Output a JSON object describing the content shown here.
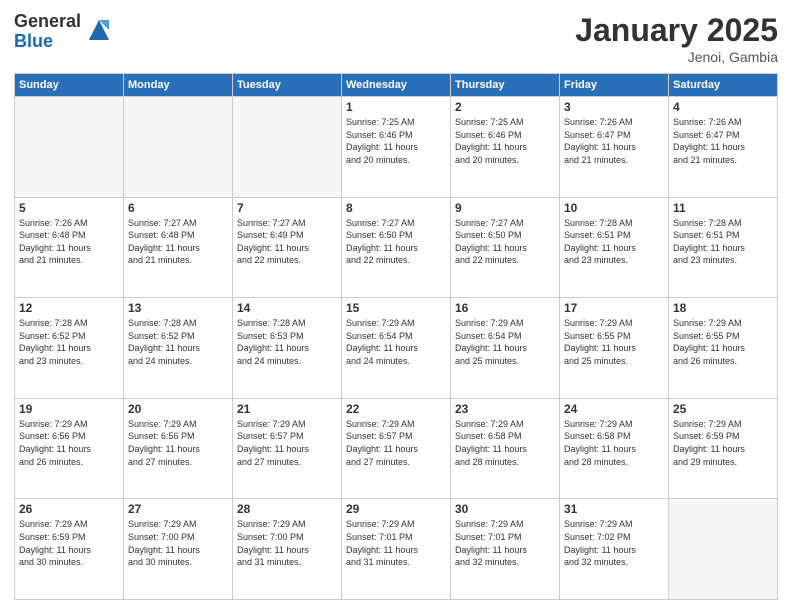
{
  "header": {
    "logo_general": "General",
    "logo_blue": "Blue",
    "title": "January 2025",
    "subtitle": "Jenoi, Gambia"
  },
  "days_of_week": [
    "Sunday",
    "Monday",
    "Tuesday",
    "Wednesday",
    "Thursday",
    "Friday",
    "Saturday"
  ],
  "weeks": [
    [
      {
        "num": "",
        "info": ""
      },
      {
        "num": "",
        "info": ""
      },
      {
        "num": "",
        "info": ""
      },
      {
        "num": "1",
        "info": "Sunrise: 7:25 AM\nSunset: 6:46 PM\nDaylight: 11 hours\nand 20 minutes."
      },
      {
        "num": "2",
        "info": "Sunrise: 7:25 AM\nSunset: 6:46 PM\nDaylight: 11 hours\nand 20 minutes."
      },
      {
        "num": "3",
        "info": "Sunrise: 7:26 AM\nSunset: 6:47 PM\nDaylight: 11 hours\nand 21 minutes."
      },
      {
        "num": "4",
        "info": "Sunrise: 7:26 AM\nSunset: 6:47 PM\nDaylight: 11 hours\nand 21 minutes."
      }
    ],
    [
      {
        "num": "5",
        "info": "Sunrise: 7:26 AM\nSunset: 6:48 PM\nDaylight: 11 hours\nand 21 minutes."
      },
      {
        "num": "6",
        "info": "Sunrise: 7:27 AM\nSunset: 6:48 PM\nDaylight: 11 hours\nand 21 minutes."
      },
      {
        "num": "7",
        "info": "Sunrise: 7:27 AM\nSunset: 6:49 PM\nDaylight: 11 hours\nand 22 minutes."
      },
      {
        "num": "8",
        "info": "Sunrise: 7:27 AM\nSunset: 6:50 PM\nDaylight: 11 hours\nand 22 minutes."
      },
      {
        "num": "9",
        "info": "Sunrise: 7:27 AM\nSunset: 6:50 PM\nDaylight: 11 hours\nand 22 minutes."
      },
      {
        "num": "10",
        "info": "Sunrise: 7:28 AM\nSunset: 6:51 PM\nDaylight: 11 hours\nand 23 minutes."
      },
      {
        "num": "11",
        "info": "Sunrise: 7:28 AM\nSunset: 6:51 PM\nDaylight: 11 hours\nand 23 minutes."
      }
    ],
    [
      {
        "num": "12",
        "info": "Sunrise: 7:28 AM\nSunset: 6:52 PM\nDaylight: 11 hours\nand 23 minutes."
      },
      {
        "num": "13",
        "info": "Sunrise: 7:28 AM\nSunset: 6:52 PM\nDaylight: 11 hours\nand 24 minutes."
      },
      {
        "num": "14",
        "info": "Sunrise: 7:28 AM\nSunset: 6:53 PM\nDaylight: 11 hours\nand 24 minutes."
      },
      {
        "num": "15",
        "info": "Sunrise: 7:29 AM\nSunset: 6:54 PM\nDaylight: 11 hours\nand 24 minutes."
      },
      {
        "num": "16",
        "info": "Sunrise: 7:29 AM\nSunset: 6:54 PM\nDaylight: 11 hours\nand 25 minutes."
      },
      {
        "num": "17",
        "info": "Sunrise: 7:29 AM\nSunset: 6:55 PM\nDaylight: 11 hours\nand 25 minutes."
      },
      {
        "num": "18",
        "info": "Sunrise: 7:29 AM\nSunset: 6:55 PM\nDaylight: 11 hours\nand 26 minutes."
      }
    ],
    [
      {
        "num": "19",
        "info": "Sunrise: 7:29 AM\nSunset: 6:56 PM\nDaylight: 11 hours\nand 26 minutes."
      },
      {
        "num": "20",
        "info": "Sunrise: 7:29 AM\nSunset: 6:56 PM\nDaylight: 11 hours\nand 27 minutes."
      },
      {
        "num": "21",
        "info": "Sunrise: 7:29 AM\nSunset: 6:57 PM\nDaylight: 11 hours\nand 27 minutes."
      },
      {
        "num": "22",
        "info": "Sunrise: 7:29 AM\nSunset: 6:57 PM\nDaylight: 11 hours\nand 27 minutes."
      },
      {
        "num": "23",
        "info": "Sunrise: 7:29 AM\nSunset: 6:58 PM\nDaylight: 11 hours\nand 28 minutes."
      },
      {
        "num": "24",
        "info": "Sunrise: 7:29 AM\nSunset: 6:58 PM\nDaylight: 11 hours\nand 28 minutes."
      },
      {
        "num": "25",
        "info": "Sunrise: 7:29 AM\nSunset: 6:59 PM\nDaylight: 11 hours\nand 29 minutes."
      }
    ],
    [
      {
        "num": "26",
        "info": "Sunrise: 7:29 AM\nSunset: 6:59 PM\nDaylight: 11 hours\nand 30 minutes."
      },
      {
        "num": "27",
        "info": "Sunrise: 7:29 AM\nSunset: 7:00 PM\nDaylight: 11 hours\nand 30 minutes."
      },
      {
        "num": "28",
        "info": "Sunrise: 7:29 AM\nSunset: 7:00 PM\nDaylight: 11 hours\nand 31 minutes."
      },
      {
        "num": "29",
        "info": "Sunrise: 7:29 AM\nSunset: 7:01 PM\nDaylight: 11 hours\nand 31 minutes."
      },
      {
        "num": "30",
        "info": "Sunrise: 7:29 AM\nSunset: 7:01 PM\nDaylight: 11 hours\nand 32 minutes."
      },
      {
        "num": "31",
        "info": "Sunrise: 7:29 AM\nSunset: 7:02 PM\nDaylight: 11 hours\nand 32 minutes."
      },
      {
        "num": "",
        "info": ""
      }
    ]
  ]
}
